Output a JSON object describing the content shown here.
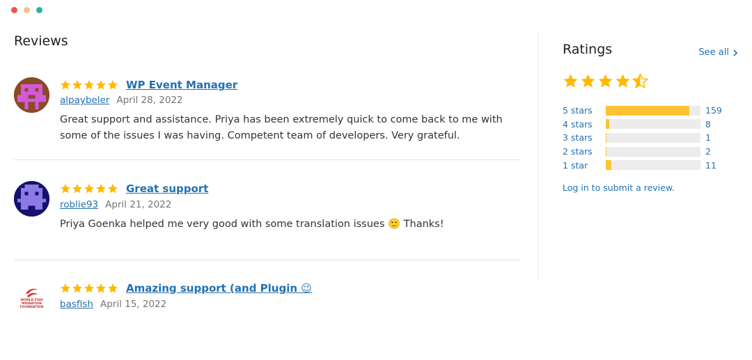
{
  "window": {
    "dot_colors": [
      "#e95353",
      "#f0c28c",
      "#2bb4a6"
    ]
  },
  "colors": {
    "accent": "#2271b1",
    "star": "#ffb900",
    "bar_fill": "#ffc233"
  },
  "reviews": {
    "heading": "Reviews",
    "items": [
      {
        "stars": 5,
        "title": "WP Event Manager",
        "author": "alpaybeler",
        "date": "April 28, 2022",
        "body": "Great support and assistance. Priya has been extremely quick to come back to me with some of the issues I was having. Competent team of developers. Very grateful."
      },
      {
        "stars": 5,
        "title": "Great support",
        "author": "roblie93",
        "date": "April 21, 2022",
        "body": "Priya Goenka helped me very good with some translation issues 🙂 Thanks!"
      },
      {
        "stars": 5,
        "title": "Amazing support (and Plugin 😉",
        "author": "basfish",
        "date": "April 15, 2022",
        "avatar_text": "WORLD FISH MIGRATION FOUNDATION"
      }
    ]
  },
  "ratings": {
    "heading": "Ratings",
    "see_all": "See all",
    "average_stars": 4.5,
    "distribution": [
      {
        "label": "5 stars",
        "count": "159",
        "fraction": 0.88
      },
      {
        "label": "4 stars",
        "count": "8",
        "fraction": 0.04
      },
      {
        "label": "3 stars",
        "count": "1",
        "fraction": 0.01
      },
      {
        "label": "2 stars",
        "count": "2",
        "fraction": 0.01
      },
      {
        "label": "1 star",
        "count": "11",
        "fraction": 0.06
      }
    ],
    "login_text": "Log in to submit a review."
  }
}
